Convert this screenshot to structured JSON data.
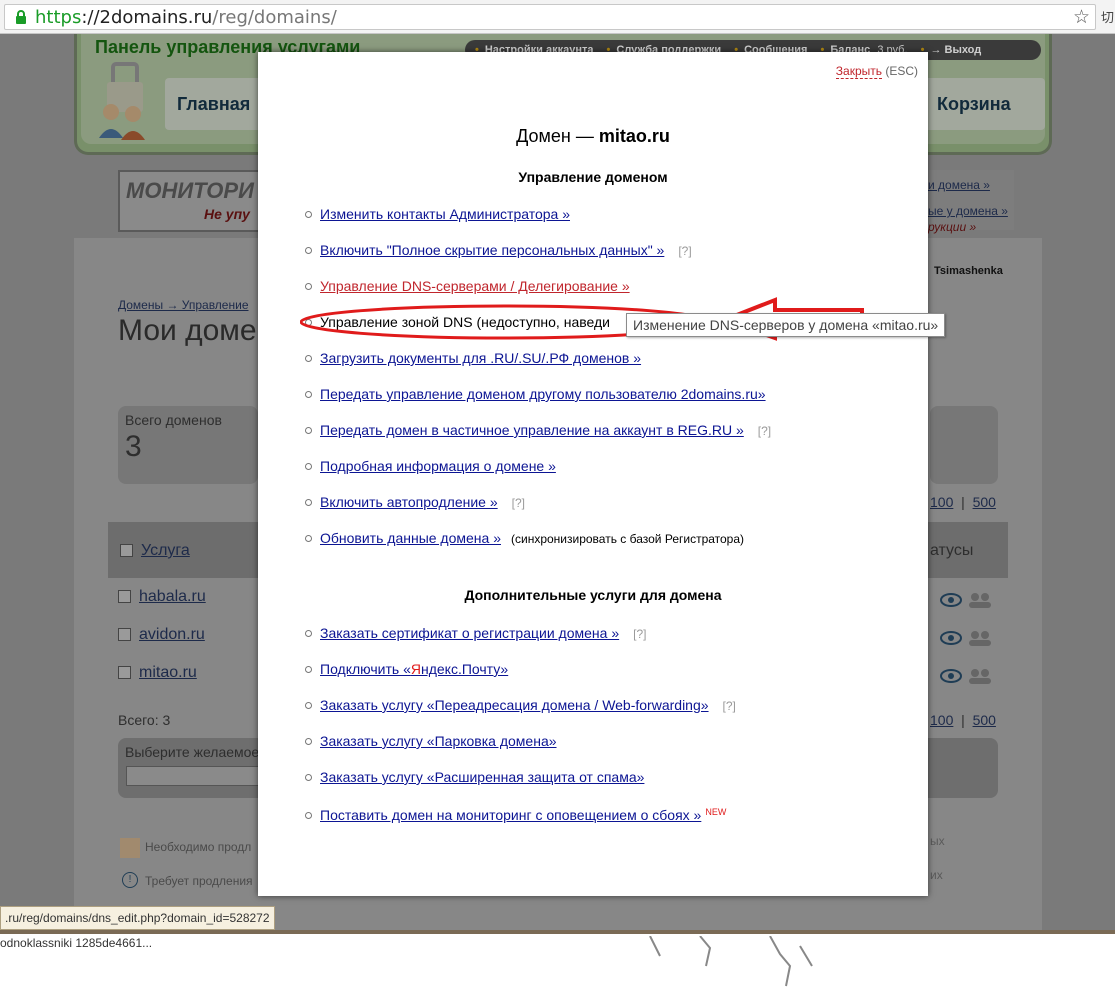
{
  "browser": {
    "url_scheme": "https",
    "url_host": "://2domains.ru",
    "url_path": "/reg/domains/",
    "edge_char": "切"
  },
  "header": {
    "panel_title": "Панель управления услугами",
    "toolbar": [
      "Настройки аккаунта",
      "Служба поддержки",
      "Сообщения"
    ],
    "balance_label": "Баланс",
    "balance_value": "3 руб.",
    "logout": "→ Выход",
    "nav_home": "Главная",
    "nav_cart": "Корзина"
  },
  "banner": {
    "logo_text": "МОНИТОРИ",
    "logo_sub": "Не упу",
    "right_link1": "и домена »",
    "right_link2": "ые у домена »",
    "right_link3": "рукции »"
  },
  "background_page": {
    "username": "Tsimashenka",
    "breadcrumb": "Домены → Управление",
    "page_title": "Мои домен",
    "total_label": "Всего доменов",
    "total_value": "3",
    "per_page": [
      "100",
      "500"
    ],
    "col_service": "Услуга",
    "col_status": "атусы",
    "domains": [
      "habala.ru",
      "avidon.ru",
      "mitao.ru"
    ],
    "total_footer": "Всего: 3",
    "select_label": "Выберите желаемое",
    "legend1": "Необходимо продл",
    "legend2": "Требует продления",
    "legend_r1": "ых",
    "legend_r2": "их"
  },
  "modal": {
    "close_label": "Закрыть",
    "close_hint": "(ESC)",
    "title_prefix": "Домен — ",
    "domain": "mitao.ru",
    "section1": "Управление доменом",
    "items1": [
      {
        "text": "Изменить контакты Администратора »"
      },
      {
        "text": "Включить \"Полное скрытие персональных данных\" »",
        "hint": "[?]"
      },
      {
        "text": "Управление DNS-серверами / Делегирование »",
        "highlight": true
      },
      {
        "text": "Управление зоной DNS (недоступно, наведи"
      },
      {
        "text": "Загрузить документы для .RU/.SU/.РФ доменов »"
      },
      {
        "text": "Передать управление доменом другому пользователю 2domains.ru»"
      },
      {
        "text": "Передать домен в частичное управление на аккаунт в REG.RU »",
        "hint": "[?]"
      },
      {
        "text": "Подробная информация о домене »"
      },
      {
        "text": "Включить автопродление »",
        "hint": "[?]"
      },
      {
        "text": "Обновить данные домена »",
        "note": "(синхронизировать с базой Регистратора)"
      }
    ],
    "section2": "Дополнительные услуги для домена",
    "items2": [
      {
        "text": "Заказать сертификат о регистрации домена »",
        "hint": "[?]"
      },
      {
        "text_before": "Подключить «",
        "text_ya": "Я",
        "text_after": "ндекс.Почту»"
      },
      {
        "text": "Заказать услугу «Переадресация домена / Web-forwarding»",
        "hint": "[?]"
      },
      {
        "text": "Заказать услугу «Парковка домена»"
      },
      {
        "text": "Заказать услугу «Расширенная защита от спама»"
      },
      {
        "text": "Поставить домен на мониторинг с оповещением о сбоях »",
        "badge": "NEW"
      }
    ]
  },
  "tooltip": "Изменение DNS-серверов у домена «mitao.ru»",
  "status_url": ".ru/reg/domains/dns_edit.php?domain_id=528272",
  "bottom_text": "odnoklassniki 1285de4661...",
  "colors": {
    "annotation": "#e01b1b",
    "link": "#0c1593",
    "link_red": "#c0262d"
  }
}
